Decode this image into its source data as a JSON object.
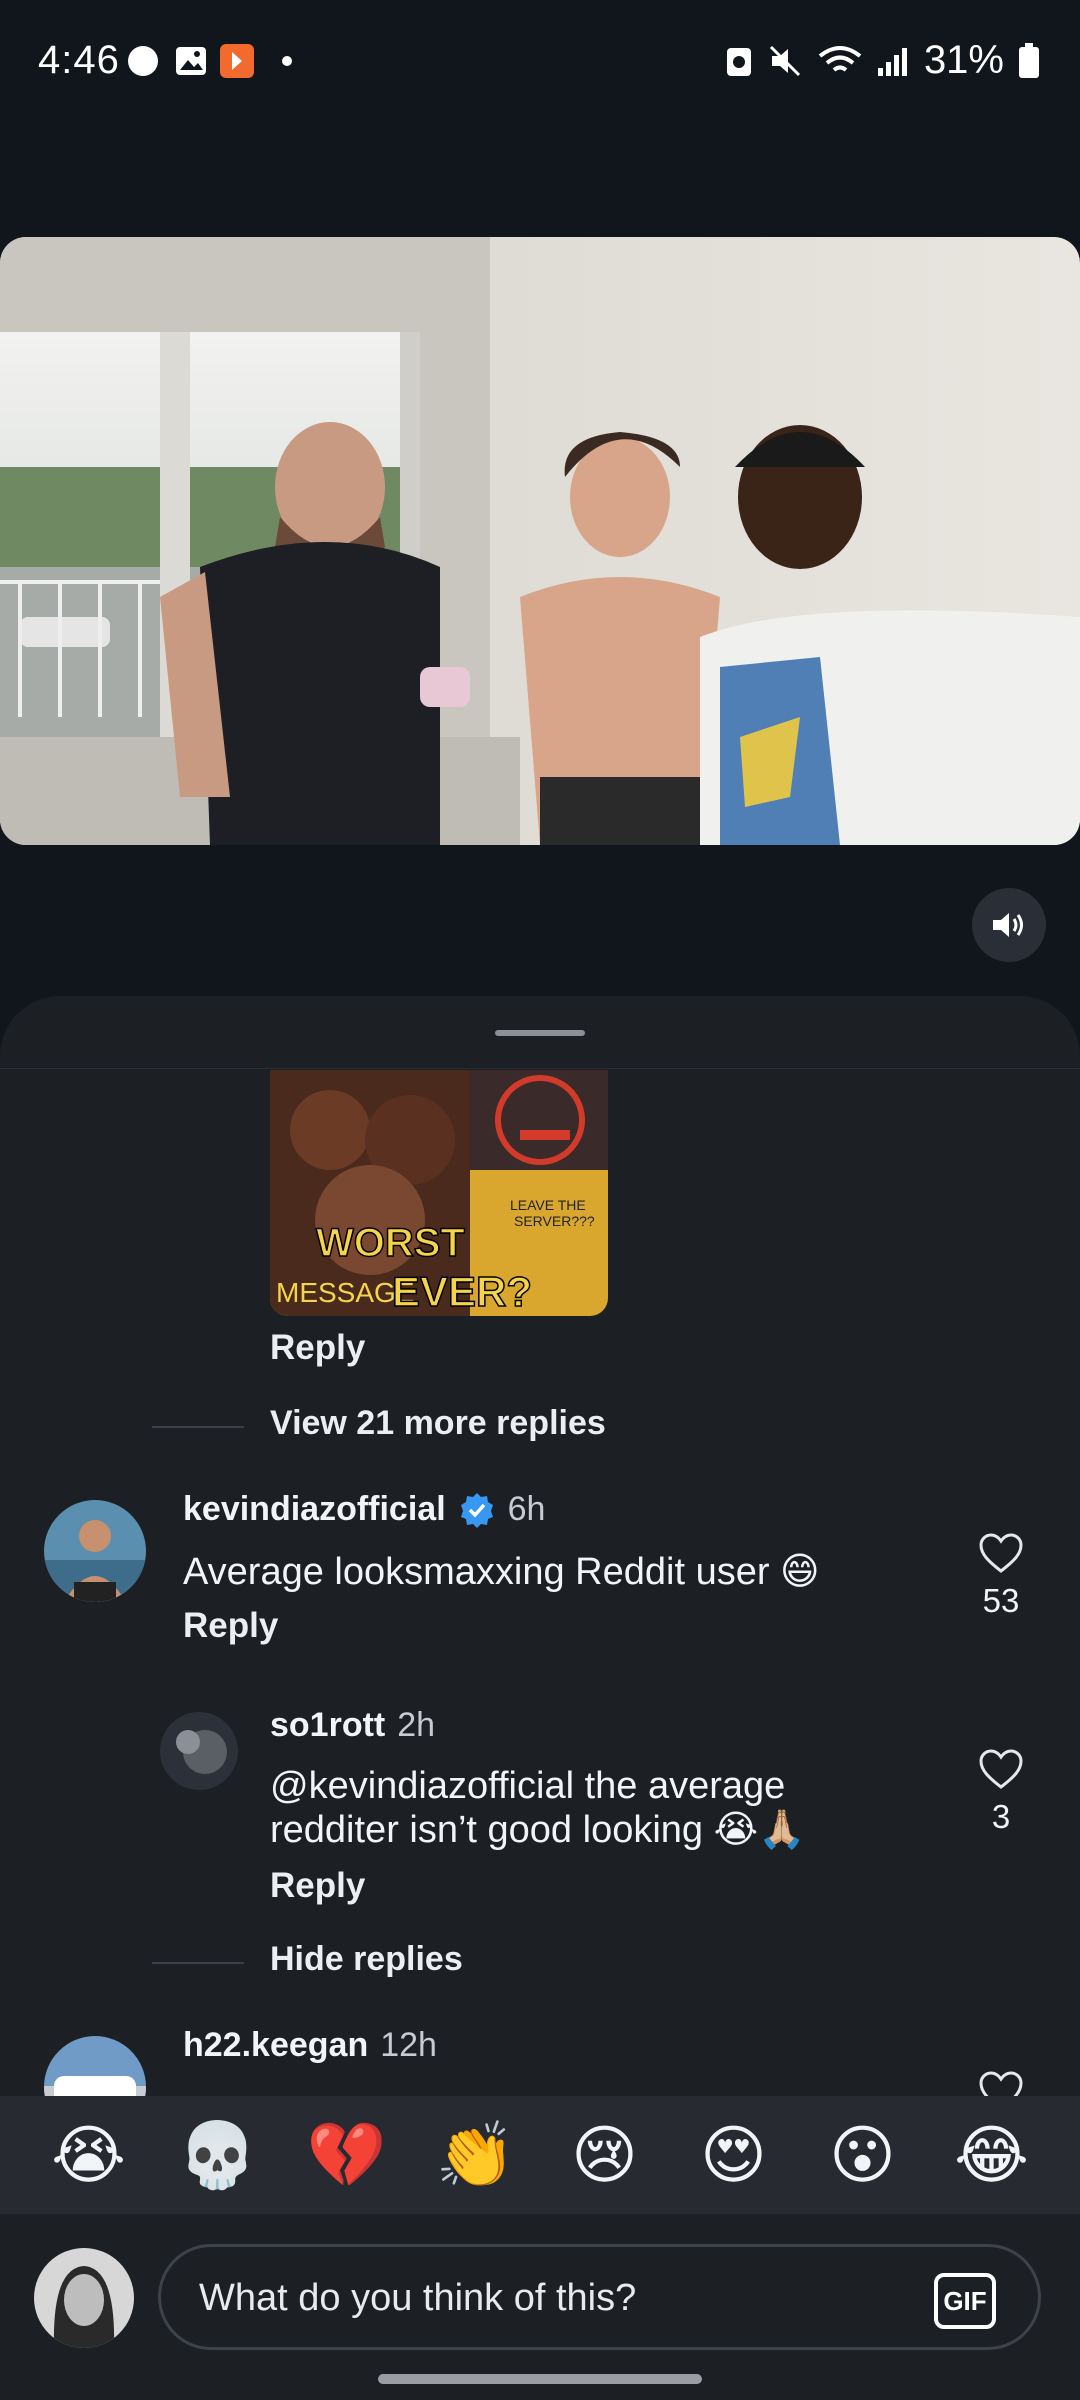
{
  "status": {
    "time": "4:46",
    "battery": "31%"
  },
  "thread": {
    "gif": {
      "caption_1": "WORST",
      "caption_2": "MESSAGE",
      "caption_3": "EVER?",
      "caption_4": "LEAVE THE",
      "caption_5": "SERVER???"
    },
    "reply_label": "Reply",
    "view_more": "View 21 more replies",
    "hide_replies": "Hide replies"
  },
  "comments": [
    {
      "username": "kevindiazofficial",
      "verified": true,
      "time": "6h",
      "text": "Average looksmaxxing Reddit user 😄",
      "reply": "Reply",
      "likes": "53"
    },
    {
      "username": "so1rott",
      "time": "2h",
      "text_line1": "@kevindiazofficial the average",
      "text_line2": "redditer isn’t good looking 😭🙏🏼",
      "reply": "Reply",
      "likes": "3"
    },
    {
      "username": "h22.keegan",
      "time": "12h"
    }
  ],
  "emoji_bar": [
    "😭",
    "💀",
    "💔",
    "👏",
    "😢",
    "😍",
    "😮",
    "😂"
  ],
  "composer": {
    "placeholder": "What do you think of this?",
    "gif_label": "GIF"
  },
  "colors": {
    "background": "#11151c",
    "sheet": "#1c1f24",
    "verified": "#3897f0"
  }
}
